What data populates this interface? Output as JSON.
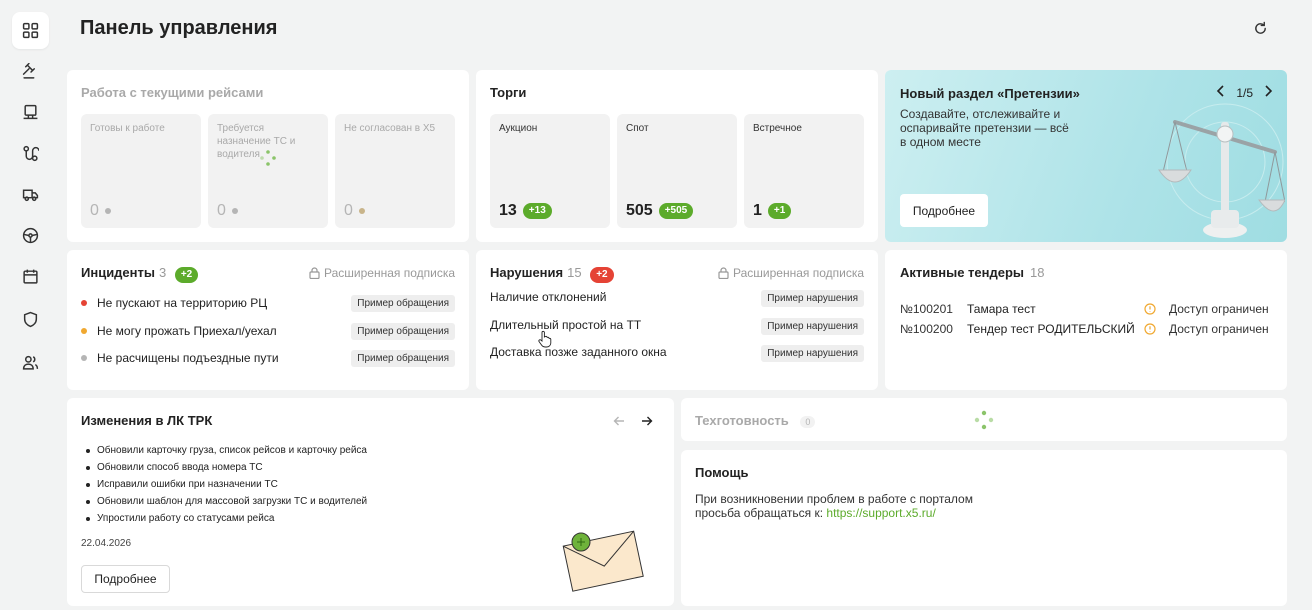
{
  "page": {
    "title": "Панель управления"
  },
  "sidebar": {
    "items": [
      {
        "name": "dashboard-icon"
      },
      {
        "name": "gavel-icon"
      },
      {
        "name": "monitor-icon"
      },
      {
        "name": "route-icon"
      },
      {
        "name": "truck-icon"
      },
      {
        "name": "steering-wheel-icon"
      },
      {
        "name": "calendar-icon"
      },
      {
        "name": "shield-icon"
      },
      {
        "name": "users-icon"
      }
    ]
  },
  "trips": {
    "title": "Работа с текущими рейсами",
    "tiles": [
      {
        "label": "Готовы к работе",
        "value": "0"
      },
      {
        "label": "Требуется назначение ТС и водителя",
        "value": "0"
      },
      {
        "label": "Не согласован в Х5",
        "value": "0"
      }
    ]
  },
  "auctions": {
    "title": "Торги",
    "tiles": [
      {
        "label": "Аукцион",
        "value": "13",
        "badge": "+13"
      },
      {
        "label": "Спот",
        "value": "505",
        "badge": "+505"
      },
      {
        "label": "Встречное",
        "value": "1",
        "badge": "+1"
      }
    ]
  },
  "promo": {
    "title": "Новый раздел «Претензии»",
    "text": "Создавайте, отслеживайте и оспаривайте претензии — всё в одном месте",
    "pager": "1/5",
    "button": "Подробнее"
  },
  "incidents": {
    "title": "Инциденты",
    "count": "3",
    "badge": "+2",
    "subscription": "Расширенная подписка",
    "items": [
      {
        "text": "Не пускают на территорию РЦ",
        "tag": "Пример обращения",
        "color": "#e54335"
      },
      {
        "text": "Не могу прожать Приехал/уехал",
        "tag": "Пример обращения",
        "color": "#f0a830"
      },
      {
        "text": "Не расчищены подъездные пути",
        "tag": "Пример обращения",
        "color": "#b5b5b5"
      }
    ]
  },
  "violations": {
    "title": "Нарушения",
    "count": "15",
    "badge": "+2",
    "subscription": "Расширенная подписка",
    "items": [
      {
        "text": "Наличие отклонений",
        "tag": "Пример нарушения"
      },
      {
        "text": "Длительный простой на ТТ",
        "tag": "Пример нарушения"
      },
      {
        "text": "Доставка позже заданного окна",
        "tag": "Пример нарушения"
      }
    ]
  },
  "tenders": {
    "title": "Активные тендеры",
    "count": "18",
    "items": [
      {
        "number": "№100201",
        "name": "Тамара тест",
        "status": "Доступ ограничен"
      },
      {
        "number": "№100200",
        "name": "Тендер тест РОДИТЕЛЬСКИЙ",
        "status": "Доступ ограничен"
      }
    ]
  },
  "changes": {
    "title": "Изменения в ЛК ТРК",
    "items": [
      "Обновили карточку груза, список рейсов и карточку рейса",
      "Обновили способ ввода номера ТС",
      "Исправили ошибки при назначении ТС",
      "Обновили шаблон для массовой загрузки ТС и водителей",
      "Упростили работу со статусами рейса"
    ],
    "date": "22.04.2026",
    "button": "Подробнее"
  },
  "techstate": {
    "title": "Техготовность",
    "count": "0"
  },
  "help": {
    "title": "Помощь",
    "line1": "При возникновении проблем в работе с порталом",
    "line2": "просьба обращаться к: ",
    "link": "https://support.x5.ru/"
  },
  "colors": {
    "accent": "#5cab2b",
    "danger": "#e54335",
    "warning": "#f0a830"
  }
}
